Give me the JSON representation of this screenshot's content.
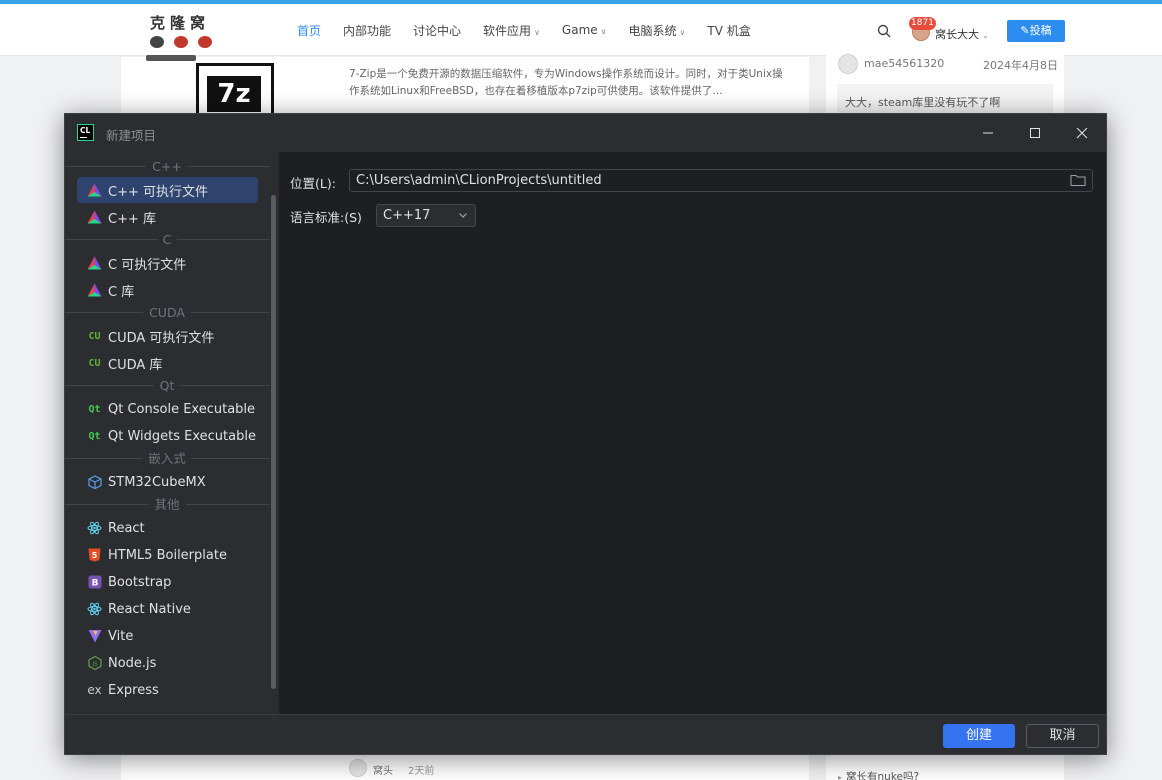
{
  "site": {
    "logo_text": "克隆窝",
    "nav": [
      {
        "label": "首页",
        "has_caret": false
      },
      {
        "label": "内部功能",
        "has_caret": false
      },
      {
        "label": "讨论中心",
        "has_caret": false
      },
      {
        "label": "软件应用",
        "has_caret": true
      },
      {
        "label": "Game",
        "has_caret": true
      },
      {
        "label": "电脑系统",
        "has_caret": true
      },
      {
        "label": "TV 机盒",
        "has_caret": false
      }
    ],
    "notification_count": "1871",
    "user_name": "窝长大大",
    "post_button": "投稿",
    "article_thumb_text": "7z",
    "article_excerpt": "7-Zip是一个免费开源的数据压缩软件，专为Windows操作系统而设计。同时，对于类Unix操作系统如Linux和FreeBSD，也存在着移植版本p7zip可供使用。该软件提供了…",
    "comment": {
      "user": "mae54561320",
      "date": "2024年4月8日",
      "text": "大大，steam库里没有玩不了啊"
    },
    "bottom_post": {
      "user": "窝头",
      "time": "2天前"
    },
    "sidebar_bottom_link": "窝长有nuke吗?"
  },
  "dialog": {
    "title": "新建项目",
    "categories": [
      {
        "label": "C++",
        "items": [
          {
            "label": "C++ 可执行文件",
            "icon": "clion-triangle-icon",
            "selected": true
          },
          {
            "label": "C++ 库",
            "icon": "clion-triangle-icon"
          }
        ]
      },
      {
        "label": "C",
        "items": [
          {
            "label": "C 可执行文件",
            "icon": "clion-triangle-icon"
          },
          {
            "label": "C 库",
            "icon": "clion-triangle-icon"
          }
        ]
      },
      {
        "label": "CUDA",
        "items": [
          {
            "label": "CUDA 可执行文件",
            "icon": "cuda-icon"
          },
          {
            "label": "CUDA 库",
            "icon": "cuda-icon"
          }
        ]
      },
      {
        "label": "Qt",
        "items": [
          {
            "label": "Qt Console Executable",
            "icon": "qt-icon"
          },
          {
            "label": "Qt Widgets Executable",
            "icon": "qt-icon"
          }
        ]
      },
      {
        "label": "嵌入式",
        "items": [
          {
            "label": "STM32CubeMX",
            "icon": "cube-icon"
          }
        ]
      },
      {
        "label": "其他",
        "items": [
          {
            "label": "React",
            "icon": "react-icon"
          },
          {
            "label": "HTML5 Boilerplate",
            "icon": "html5-icon"
          },
          {
            "label": "Bootstrap",
            "icon": "bootstrap-icon"
          },
          {
            "label": "React Native",
            "icon": "react-icon"
          },
          {
            "label": "Vite",
            "icon": "vite-icon"
          },
          {
            "label": "Node.js",
            "icon": "nodejs-icon"
          },
          {
            "label": "Express",
            "icon": "express-icon"
          }
        ]
      }
    ],
    "location_label": "位置(L):",
    "location_value": "C:\\Users\\admin\\CLionProjects\\untitled",
    "language_label": "语言标准:(S)",
    "language_value": "C++17",
    "create_button": "创建",
    "cancel_button": "取消",
    "app_icon_text": "CL"
  },
  "colors": {
    "accent": "#3574f0",
    "selection": "#2e436e",
    "dialog_bg": "#2b2d30",
    "content_bg": "#1e1f22",
    "site_accent": "#2d8cf0"
  }
}
